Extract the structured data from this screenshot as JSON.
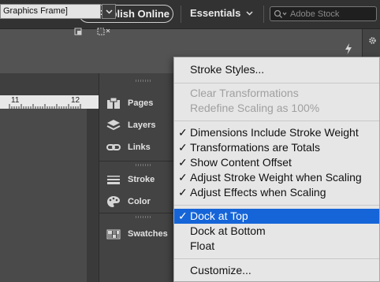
{
  "header": {
    "publish_label": "Publish Online",
    "workspace_label": "Essentials",
    "search_placeholder": "Adobe Stock"
  },
  "control": {
    "frame_type_value": "Graphics Frame]"
  },
  "ruler": {
    "ticks": [
      "11",
      "12"
    ]
  },
  "panels": [
    {
      "label": "Pages",
      "icon": "pages-icon"
    },
    {
      "label": "Layers",
      "icon": "layers-icon"
    },
    {
      "label": "Links",
      "icon": "links-icon"
    },
    {
      "label": "Stroke",
      "icon": "stroke-icon"
    },
    {
      "label": "Color",
      "icon": "color-icon"
    },
    {
      "label": "Swatches",
      "icon": "swatches-icon"
    }
  ],
  "menu": {
    "items": [
      {
        "label": "Stroke Styles...",
        "checked": false,
        "disabled": false
      },
      {
        "label": "Clear Transformations",
        "checked": false,
        "disabled": true
      },
      {
        "label": "Redefine Scaling as 100%",
        "checked": false,
        "disabled": true
      },
      {
        "label": "Dimensions Include Stroke Weight",
        "checked": true,
        "disabled": false
      },
      {
        "label": "Transformations are Totals",
        "checked": true,
        "disabled": false
      },
      {
        "label": "Show Content Offset",
        "checked": true,
        "disabled": false
      },
      {
        "label": "Adjust Stroke Weight when Scaling",
        "checked": true,
        "disabled": false
      },
      {
        "label": "Adjust Effects when Scaling",
        "checked": true,
        "disabled": false
      },
      {
        "label": "Dock at Top",
        "checked": true,
        "disabled": false,
        "highlighted": true
      },
      {
        "label": "Dock at Bottom",
        "checked": false,
        "disabled": false
      },
      {
        "label": "Float",
        "checked": false,
        "disabled": false
      },
      {
        "label": "Customize...",
        "checked": false,
        "disabled": false
      }
    ],
    "check_glyph": "✓"
  },
  "colors": {
    "highlight": "#1565d8",
    "menu_bg": "#e6e6e6",
    "app_bg": "#535353",
    "topbar_bg": "#323232"
  }
}
